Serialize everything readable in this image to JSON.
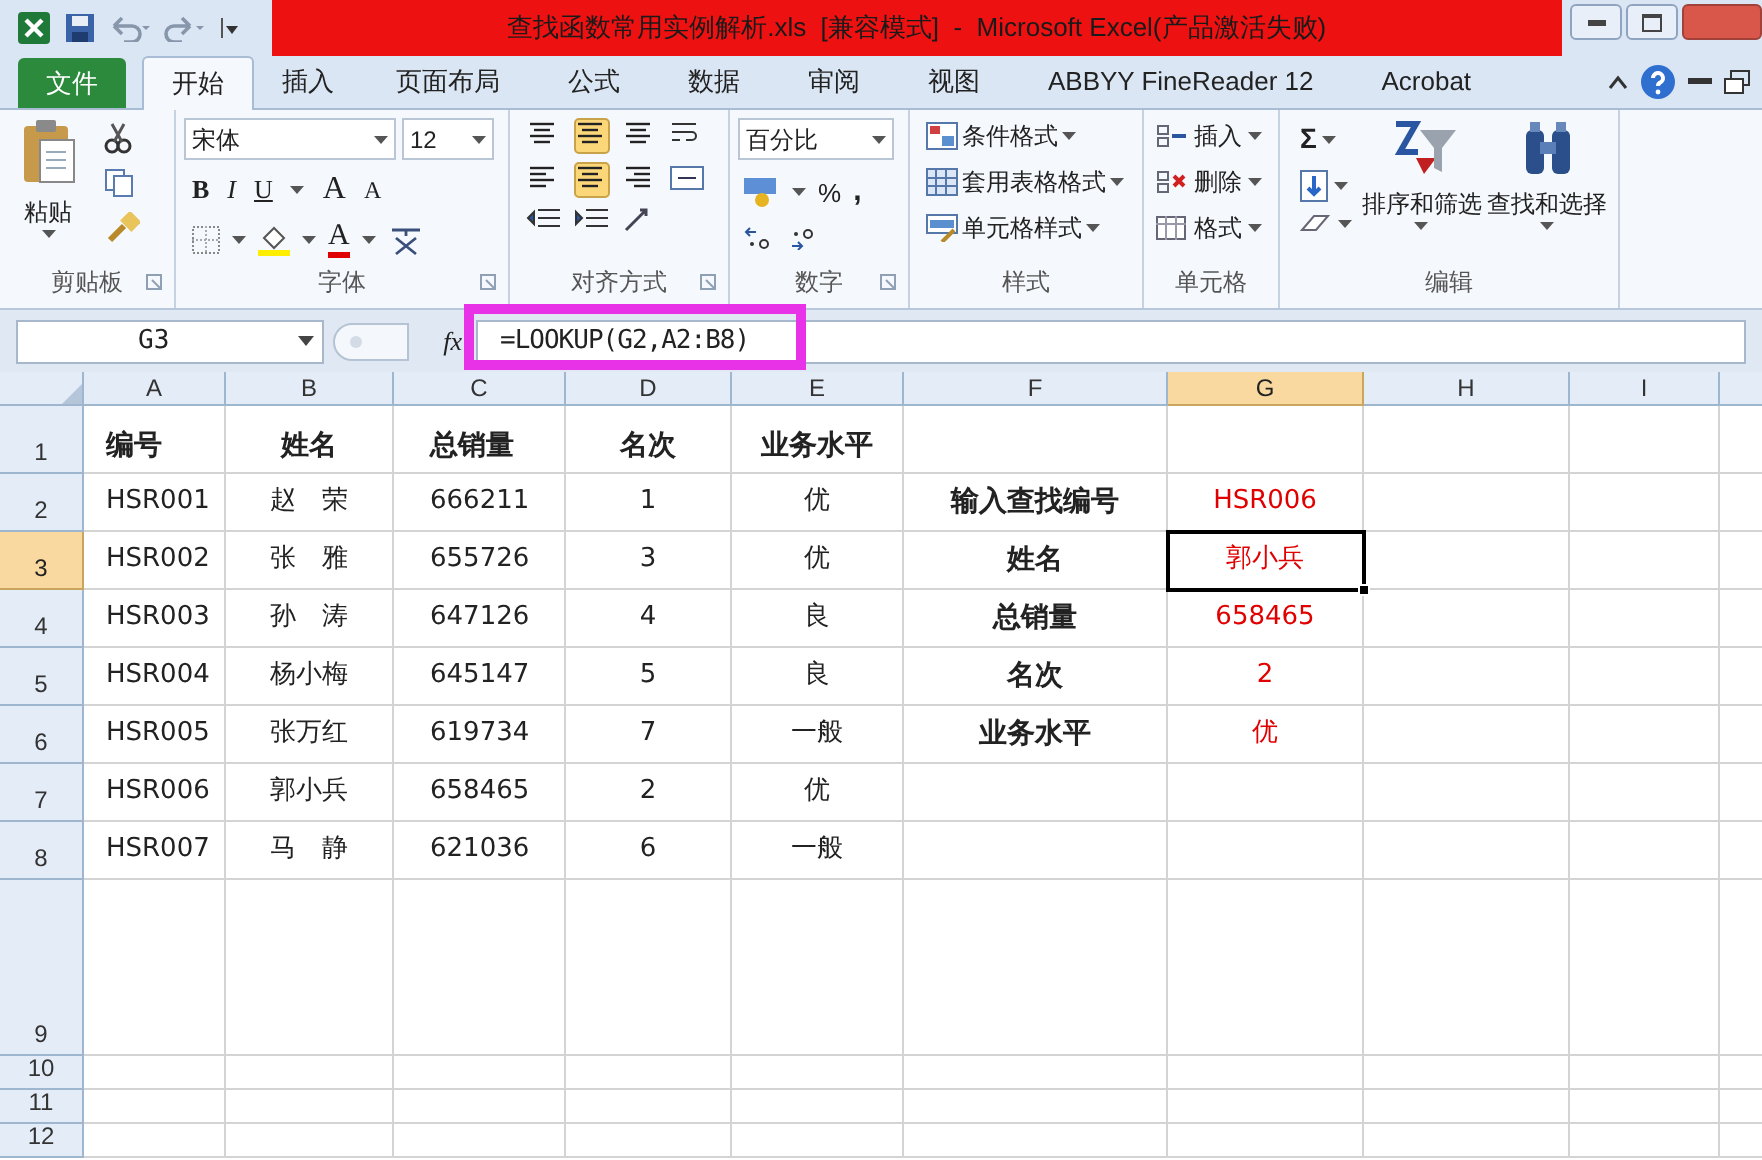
{
  "title_bar": {
    "title": "查找函数常用实例解析.xls  [兼容模式]  -  Microsoft Excel(产品激活失败)"
  },
  "tabs": [
    {
      "label": "文件",
      "kind": "file",
      "selected": false
    },
    {
      "label": "开始",
      "kind": "tab",
      "selected": true
    },
    {
      "label": "插入",
      "kind": "tab",
      "selected": false
    },
    {
      "label": "页面布局",
      "kind": "tab",
      "selected": false
    },
    {
      "label": "公式",
      "kind": "tab",
      "selected": false
    },
    {
      "label": "数据",
      "kind": "tab",
      "selected": false
    },
    {
      "label": "审阅",
      "kind": "tab",
      "selected": false
    },
    {
      "label": "视图",
      "kind": "tab",
      "selected": false
    },
    {
      "label": "ABBYY FineReader 12",
      "kind": "tab",
      "selected": false
    },
    {
      "label": "Acrobat",
      "kind": "tab",
      "selected": false
    }
  ],
  "ribbon": {
    "clipboard": {
      "label": "剪贴板",
      "paste": "粘贴"
    },
    "font": {
      "label": "字体",
      "font_name": "宋体",
      "font_size": "12",
      "style_buttons": [
        "B",
        "I",
        "U"
      ],
      "size_buttons": [
        "A",
        "A"
      ],
      "font_color": "A"
    },
    "alignment": {
      "label": "对齐方式"
    },
    "number": {
      "label": "数字",
      "format": "百分比",
      "percent": "%",
      "comma": ","
    },
    "styles": {
      "label": "样式",
      "items": [
        "条件格式",
        "套用表格格式",
        "单元格样式"
      ]
    },
    "cells": {
      "label": "单元格",
      "items": [
        "插入",
        "删除",
        "格式"
      ]
    },
    "editing": {
      "label": "编辑",
      "sum": "Σ",
      "buttons": [
        "排序和筛选",
        "查找和选择"
      ]
    }
  },
  "formula_bar": {
    "name_box": "G3",
    "fx": "fx",
    "formula": "=LOOKUP(G2,A2:B8)"
  },
  "sheet": {
    "columns": [
      {
        "label": "A",
        "kind": "code",
        "selected": false
      },
      {
        "label": "B",
        "kind": "name",
        "selected": false
      },
      {
        "label": "C",
        "kind": "amount",
        "selected": false
      },
      {
        "label": "D",
        "kind": "rank",
        "selected": false
      },
      {
        "label": "E",
        "kind": "grade",
        "selected": false
      },
      {
        "label": "F",
        "kind": "label",
        "selected": false
      },
      {
        "label": "G",
        "kind": "result",
        "selected": true
      },
      {
        "label": "H",
        "selected": false
      },
      {
        "label": "I",
        "selected": false
      }
    ],
    "rows": [
      {
        "number": "1",
        "kind": "header",
        "selected": false,
        "cells": [
          "编号",
          "姓名",
          "总销量",
          "名次",
          "业务水平",
          null,
          null,
          null,
          null
        ]
      },
      {
        "number": "2",
        "kind": "data",
        "selected": false,
        "cells": [
          "HSR001",
          "赵　荣",
          "666211",
          "1",
          "优",
          "输入查找编号",
          "HSR006",
          null,
          null
        ]
      },
      {
        "number": "3",
        "kind": "data",
        "selected": true,
        "cells": [
          "HSR002",
          "张　雅",
          "655726",
          "3",
          "优",
          "姓名",
          "郭小兵",
          null,
          null
        ]
      },
      {
        "number": "4",
        "kind": "data",
        "selected": false,
        "cells": [
          "HSR003",
          "孙　涛",
          "647126",
          "4",
          "良",
          "总销量",
          "658465",
          null,
          null
        ]
      },
      {
        "number": "5",
        "kind": "data",
        "selected": false,
        "cells": [
          "HSR004",
          "杨小梅",
          "645147",
          "5",
          "良",
          "名次",
          "2",
          null,
          null
        ]
      },
      {
        "number": "6",
        "kind": "data",
        "selected": false,
        "cells": [
          "HSR005",
          "张万红",
          "619734",
          "7",
          "一般",
          "业务水平",
          "优",
          null,
          null
        ]
      },
      {
        "number": "7",
        "kind": "data",
        "selected": false,
        "cells": [
          "HSR006",
          "郭小兵",
          "658465",
          "2",
          "优",
          null,
          null,
          null,
          null
        ]
      },
      {
        "number": "8",
        "kind": "data",
        "selected": false,
        "cells": [
          "HSR007",
          "马　静",
          "621036",
          "6",
          "一般",
          null,
          null,
          null,
          null
        ]
      },
      {
        "number": "9",
        "kind": "tall",
        "selected": false
      },
      {
        "number": "10",
        "kind": "short",
        "selected": false
      },
      {
        "number": "11",
        "kind": "short",
        "selected": false
      },
      {
        "number": "12",
        "kind": "short",
        "selected": false
      }
    ]
  }
}
